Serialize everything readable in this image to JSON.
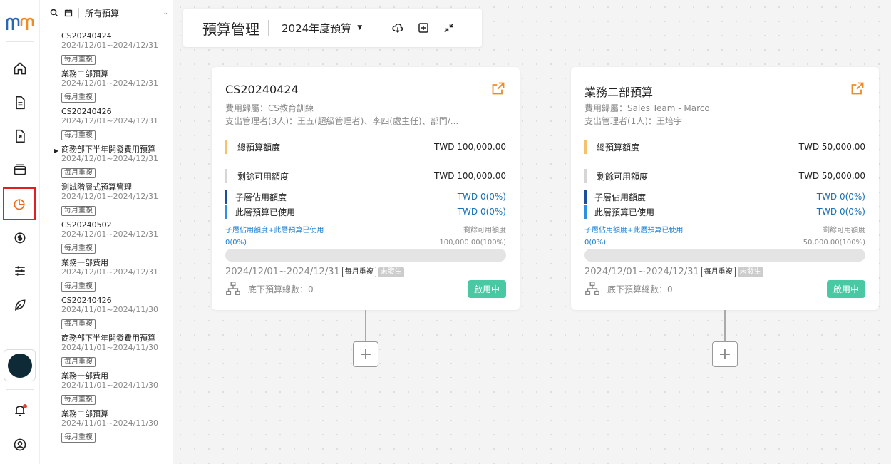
{
  "nav": {
    "icons": [
      "home-icon",
      "document-icon",
      "document-export-icon",
      "credit-card-icon",
      "budget-chart-icon",
      "money-exchange-icon",
      "sliders-icon",
      "leaf-icon"
    ],
    "active_index": 4,
    "notification_unread": true,
    "colors": {
      "active_outline": "#e02020",
      "logo_blue": "#2a67b1",
      "logo_orange": "#f08a24"
    }
  },
  "sidebar": {
    "filter_label": "所有預算",
    "items": [
      {
        "name": "CS20240424",
        "dates": "2024/12/01~2024/12/31",
        "tag": "每月重複",
        "has_children": false
      },
      {
        "name": "業務二部預算",
        "dates": "2024/12/01~2024/12/31",
        "tag": "每月重複",
        "has_children": false
      },
      {
        "name": "CS20240426",
        "dates": "2024/12/01~2024/12/31",
        "tag": "每月重複",
        "has_children": false
      },
      {
        "name": "商務部下半年開發費用預算",
        "dates": "2024/12/01~2024/12/31",
        "tag": "每月重複",
        "has_children": true
      },
      {
        "name": "測試階層式預算管理",
        "dates": "2024/12/01~2024/12/31",
        "tag": "每月重複",
        "has_children": false
      },
      {
        "name": "CS20240502",
        "dates": "2024/12/01~2024/12/31",
        "tag": "每月重複",
        "has_children": false
      },
      {
        "name": "業務一部費用",
        "dates": "2024/12/01~2024/12/31",
        "tag": "每月重複",
        "has_children": false
      },
      {
        "name": "CS20240426",
        "dates": "2024/11/01~2024/11/30",
        "tag": "每月重複",
        "has_children": false
      },
      {
        "name": "商務部下半年開發費用預算",
        "dates": "2024/11/01~2024/11/30",
        "tag": "每月重複",
        "has_children": false
      },
      {
        "name": "業務一部費用",
        "dates": "2024/11/01~2024/11/30",
        "tag": "每月重複",
        "has_children": false
      },
      {
        "name": "業務二部預算",
        "dates": "2024/11/01~2024/11/30",
        "tag": "每月重複",
        "has_children": false
      }
    ]
  },
  "toolbar": {
    "title": "預算管理",
    "year_select": "2024年度預算"
  },
  "cards": [
    {
      "name": "CS20240424",
      "category": "費用歸屬：CS教育訓練",
      "managers": "支出管理者(3人)：王五(超級管理者)、李四(處主任)、部門/...",
      "total_label": "總預算額度",
      "total_value": "TWD 100,000.00",
      "remaining_label": "剩餘可用額度",
      "remaining_value": "TWD 100,000.00",
      "child_label": "子層佔用額度",
      "child_value": "TWD 0(0%)",
      "used_label": "此層預算已使用",
      "used_value": "TWD 0(0%)",
      "info_left_label": "子層佔用額度+此層預算已使用",
      "info_left_value": "0(0%)",
      "info_right_label": "剩餘可用額度",
      "info_right_value": "100,000.00(100%)",
      "progress": 0,
      "period": "2024/12/01~2024/12/31",
      "repeat_tag": "每月重複",
      "state_tag": "未發生",
      "sub_count": "底下預算總數：0",
      "status": "啟用中"
    },
    {
      "name": "業務二部預算",
      "category": "費用歸屬：Sales Team - Marco",
      "managers": "支出管理者(1人)：王培宇",
      "total_label": "總預算額度",
      "total_value": "TWD 50,000.00",
      "remaining_label": "剩餘可用額度",
      "remaining_value": "TWD 50,000.00",
      "child_label": "子層佔用額度",
      "child_value": "TWD 0(0%)",
      "used_label": "此層預算已使用",
      "used_value": "TWD 0(0%)",
      "info_left_label": "子層佔用額度+此層預算已使用",
      "info_left_value": "0(0%)",
      "info_right_label": "剩餘可用額度",
      "info_right_value": "50,000.00(100%)",
      "progress": 0,
      "period": "2024/12/01~2024/12/31",
      "repeat_tag": "每月重複",
      "state_tag": "未發生",
      "sub_count": "底下預算總數：0",
      "status": "啟用中"
    }
  ]
}
